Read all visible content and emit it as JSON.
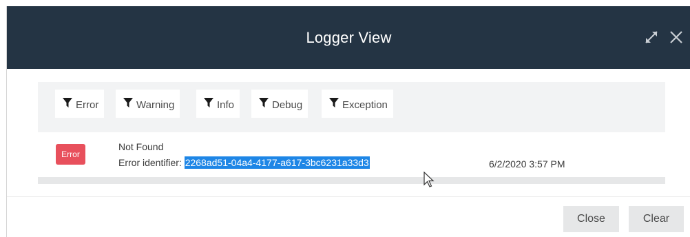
{
  "dialog": {
    "title": "Logger View",
    "expand_icon": "expand-arrows-icon",
    "close_icon": "close-x-icon"
  },
  "filters": [
    {
      "label": "Error",
      "icon": "filter-funnel-icon"
    },
    {
      "label": "Warning",
      "icon": "filter-funnel-icon"
    },
    {
      "label": "Info",
      "icon": "filter-funnel-icon"
    },
    {
      "label": "Debug",
      "icon": "filter-funnel-icon"
    },
    {
      "label": "Exception",
      "icon": "filter-funnel-icon"
    }
  ],
  "log_entries": [
    {
      "level": "Error",
      "level_color": "#e8505c",
      "message": "Not Found",
      "identifier_label": "Error identifier:",
      "identifier": "2268ad51-04a4-4177-a617-3bc6231a33d3",
      "timestamp": "6/2/2020 3:57 PM"
    }
  ],
  "footer": {
    "close_label": "Close",
    "clear_label": "Clear"
  },
  "colors": {
    "header": "#243444",
    "selection": "#1e86e6",
    "filter_bar": "#f2f3f4",
    "button": "#e6e7e8"
  }
}
